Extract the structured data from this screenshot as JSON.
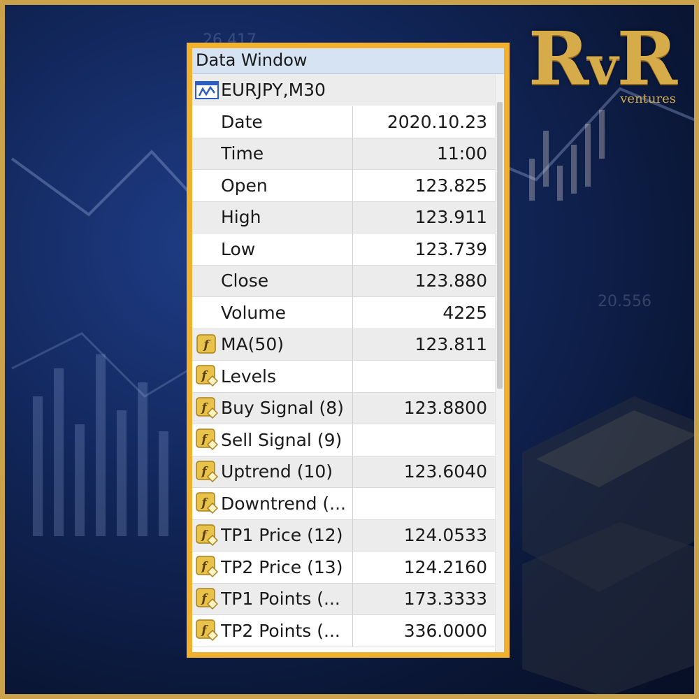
{
  "window": {
    "title": "Data Window",
    "symbol": "EURJPY,M30"
  },
  "rows": [
    {
      "label": "Date",
      "value": "2020.10.23",
      "icon": "none"
    },
    {
      "label": "Time",
      "value": "11:00",
      "icon": "none"
    },
    {
      "label": "Open",
      "value": "123.825",
      "icon": "none"
    },
    {
      "label": "High",
      "value": "123.911",
      "icon": "none"
    },
    {
      "label": "Low",
      "value": "123.739",
      "icon": "none"
    },
    {
      "label": "Close",
      "value": "123.880",
      "icon": "none"
    },
    {
      "label": "Volume",
      "value": "4225",
      "icon": "none"
    },
    {
      "label": "MA(50)",
      "value": "123.811",
      "icon": "function-icon"
    },
    {
      "label": "Levels",
      "value": "",
      "icon": "custom-indicator-icon"
    },
    {
      "label": "Buy Signal (8)",
      "value": "123.8800",
      "icon": "custom-indicator-icon"
    },
    {
      "label": "Sell Signal (9)",
      "value": "",
      "icon": "custom-indicator-icon"
    },
    {
      "label": "Uptrend (10)",
      "value": "123.6040",
      "icon": "custom-indicator-icon"
    },
    {
      "label": "Downtrend (...",
      "value": "",
      "icon": "custom-indicator-icon"
    },
    {
      "label": "TP1 Price (12)",
      "value": "124.0533",
      "icon": "custom-indicator-icon"
    },
    {
      "label": "TP2 Price (13)",
      "value": "124.2160",
      "icon": "custom-indicator-icon"
    },
    {
      "label": "TP1 Points (...",
      "value": "173.3333",
      "icon": "custom-indicator-icon"
    },
    {
      "label": "TP2 Points (...",
      "value": "336.0000",
      "icon": "custom-indicator-icon"
    }
  ],
  "background": {
    "numbers": [
      "26.417",
      "20.556"
    ]
  },
  "logo": {
    "mark_r1": "R",
    "mark_v": "v",
    "mark_r2": "R",
    "sub": "ventures"
  },
  "colors": {
    "frame": "#c9a24a",
    "window_border": "#f0b12e",
    "title_bar": "#d5e3f3",
    "row_alt": "#ececec"
  }
}
